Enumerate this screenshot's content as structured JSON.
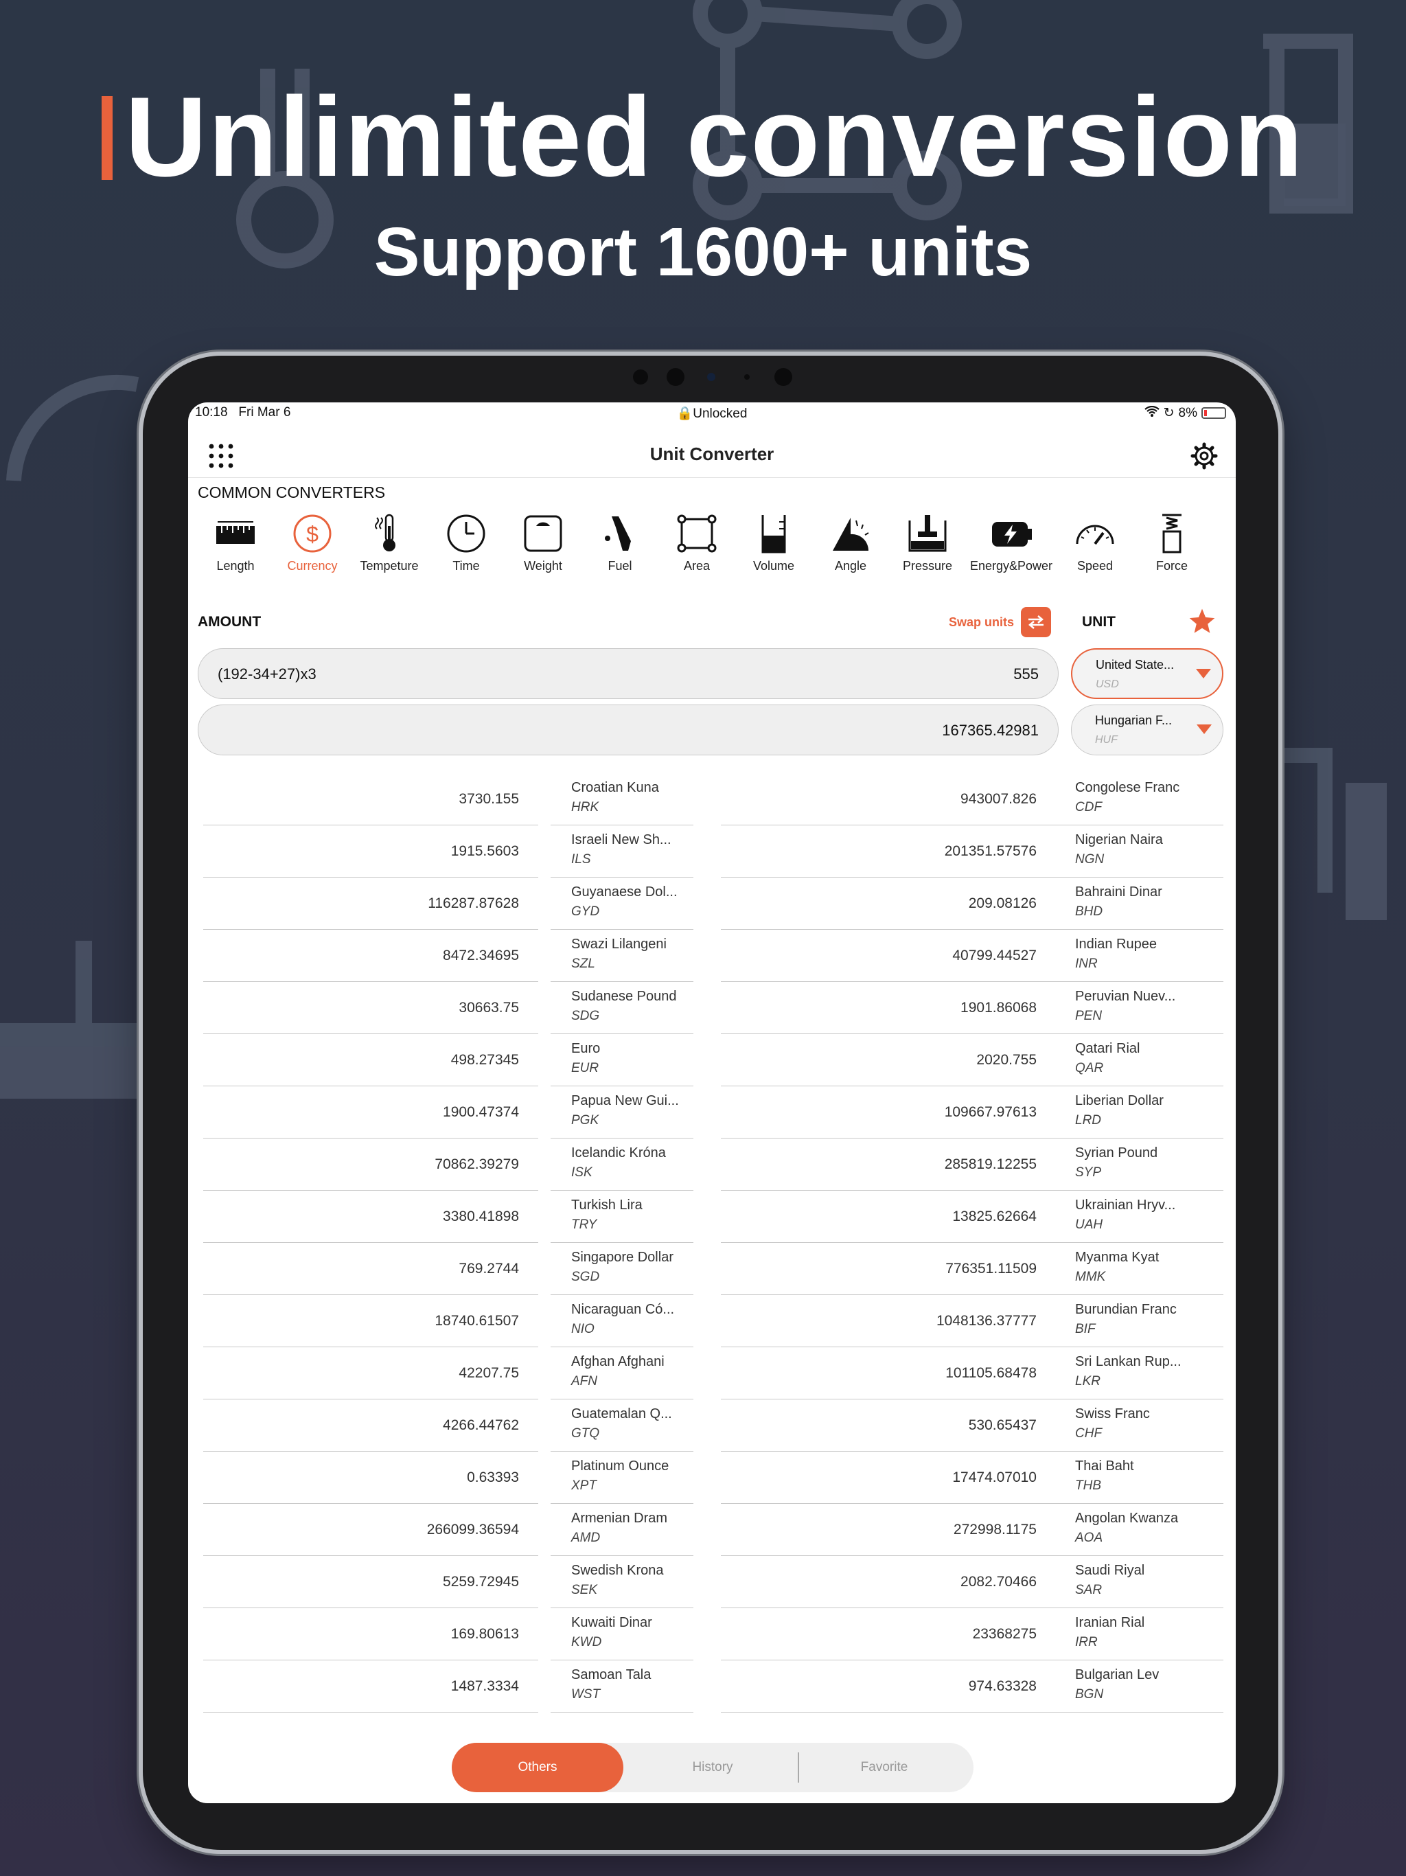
{
  "promo": {
    "headline": "Unlimited conversion",
    "subheadline": "Support 1600+ units"
  },
  "status_bar": {
    "time": "10:18",
    "date": "Fri Mar 6",
    "lock_label": "Unlocked",
    "battery": "8%"
  },
  "nav": {
    "title": "Unit Converter",
    "menu_icon": "grid-icon",
    "settings_icon": "gear-icon"
  },
  "common_converters": {
    "title": "COMMON CONVERTERS",
    "items": [
      {
        "label": "Length",
        "icon": "ruler-icon"
      },
      {
        "label": "Currency",
        "icon": "dollar-icon",
        "active": true
      },
      {
        "label": "Tempeture",
        "icon": "thermometer-icon"
      },
      {
        "label": "Time",
        "icon": "clock-icon"
      },
      {
        "label": "Weight",
        "icon": "scale-icon"
      },
      {
        "label": "Fuel",
        "icon": "fuel-nozzle-icon"
      },
      {
        "label": "Area",
        "icon": "area-icon"
      },
      {
        "label": "Volume",
        "icon": "beaker-icon"
      },
      {
        "label": "Angle",
        "icon": "angle-icon"
      },
      {
        "label": "Pressure",
        "icon": "pressure-icon"
      },
      {
        "label": "Energy&Power",
        "icon": "battery-bolt-icon"
      },
      {
        "label": "Speed",
        "icon": "speedometer-icon"
      },
      {
        "label": "Force",
        "icon": "spring-icon"
      }
    ]
  },
  "amount": {
    "label": "AMOUNT",
    "swap_label": "Swap units",
    "unit_label": "UNIT",
    "input_expression": "(192-34+27)x3",
    "input_value": "555",
    "output_value": "167365.42981",
    "from_unit": {
      "name": "United State...",
      "code": "USD"
    },
    "to_unit": {
      "name": "Hungarian F...",
      "code": "HUF"
    }
  },
  "results_left": [
    {
      "value": "3730.155",
      "name": "Croatian Kuna",
      "code": "HRK"
    },
    {
      "value": "1915.5603",
      "name": "Israeli New Sh...",
      "code": "ILS"
    },
    {
      "value": "116287.87628",
      "name": "Guyanaese Dol...",
      "code": "GYD"
    },
    {
      "value": "8472.34695",
      "name": "Swazi Lilangeni",
      "code": "SZL"
    },
    {
      "value": "30663.75",
      "name": "Sudanese Pound",
      "code": "SDG"
    },
    {
      "value": "498.27345",
      "name": "Euro",
      "code": "EUR"
    },
    {
      "value": "1900.47374",
      "name": "Papua New Gui...",
      "code": "PGK"
    },
    {
      "value": "70862.39279",
      "name": "Icelandic Króna",
      "code": "ISK"
    },
    {
      "value": "3380.41898",
      "name": "Turkish Lira",
      "code": "TRY"
    },
    {
      "value": "769.2744",
      "name": "Singapore Dollar",
      "code": "SGD"
    },
    {
      "value": "18740.61507",
      "name": "Nicaraguan Có...",
      "code": "NIO"
    },
    {
      "value": "42207.75",
      "name": "Afghan Afghani",
      "code": "AFN"
    },
    {
      "value": "4266.44762",
      "name": "Guatemalan Q...",
      "code": "GTQ"
    },
    {
      "value": "0.63393",
      "name": "Platinum Ounce",
      "code": "XPT"
    },
    {
      "value": "266099.36594",
      "name": "Armenian Dram",
      "code": "AMD"
    },
    {
      "value": "5259.72945",
      "name": "Swedish Krona",
      "code": "SEK"
    },
    {
      "value": "169.80613",
      "name": "Kuwaiti Dinar",
      "code": "KWD"
    },
    {
      "value": "1487.3334",
      "name": "Samoan Tala",
      "code": "WST"
    }
  ],
  "results_right": [
    {
      "value": "943007.826",
      "name": "Congolese Franc",
      "code": "CDF"
    },
    {
      "value": "201351.57576",
      "name": "Nigerian Naira",
      "code": "NGN"
    },
    {
      "value": "209.08126",
      "name": "Bahraini Dinar",
      "code": "BHD"
    },
    {
      "value": "40799.44527",
      "name": "Indian Rupee",
      "code": "INR"
    },
    {
      "value": "1901.86068",
      "name": "Peruvian Nuev...",
      "code": "PEN"
    },
    {
      "value": "2020.755",
      "name": "Qatari Rial",
      "code": "QAR"
    },
    {
      "value": "109667.97613",
      "name": "Liberian Dollar",
      "code": "LRD"
    },
    {
      "value": "285819.12255",
      "name": "Syrian Pound",
      "code": "SYP"
    },
    {
      "value": "13825.62664",
      "name": "Ukrainian Hryv...",
      "code": "UAH"
    },
    {
      "value": "776351.11509",
      "name": "Myanma Kyat",
      "code": "MMK"
    },
    {
      "value": "1048136.37777",
      "name": "Burundian Franc",
      "code": "BIF"
    },
    {
      "value": "101105.68478",
      "name": "Sri Lankan Rup...",
      "code": "LKR"
    },
    {
      "value": "530.65437",
      "name": "Swiss Franc",
      "code": "CHF"
    },
    {
      "value": "17474.07010",
      "name": "Thai Baht",
      "code": "THB"
    },
    {
      "value": "272998.1175",
      "name": "Angolan Kwanza",
      "code": "AOA"
    },
    {
      "value": "2082.70466",
      "name": "Saudi Riyal",
      "code": "SAR"
    },
    {
      "value": "23368275",
      "name": "Iranian Rial",
      "code": "IRR"
    },
    {
      "value": "974.63328",
      "name": "Bulgarian Lev",
      "code": "BGN"
    }
  ],
  "tabs": [
    {
      "label": "Others",
      "active": true
    },
    {
      "label": "History",
      "active": false
    },
    {
      "label": "Favorite",
      "active": false
    }
  ],
  "colors": {
    "accent": "#e8623c",
    "background": "#2e3446"
  }
}
